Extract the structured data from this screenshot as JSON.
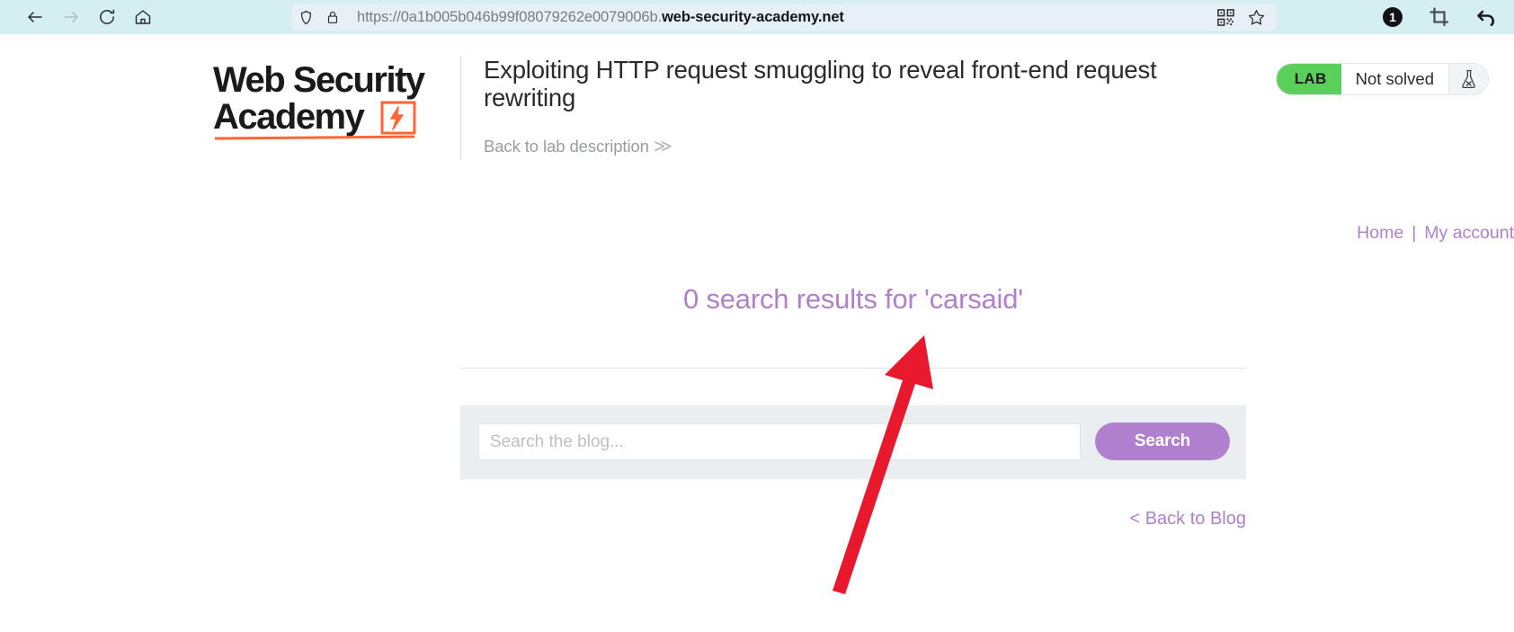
{
  "browser": {
    "nav": {
      "back_icon": "arrow-left-icon",
      "forward_icon": "arrow-right-icon",
      "reload_icon": "reload-icon",
      "home_icon": "home-icon"
    },
    "url_bar": {
      "shield_icon": "shield-icon",
      "lock_icon": "lock-icon",
      "url_prefix": "https://0a1b005b046b99f08079262e0079006b.",
      "url_domain": "web-security-academy.net",
      "qr_icon": "qr-code-icon",
      "bookmark_icon": "star-icon"
    },
    "extensions": {
      "badge_count": "1",
      "badge_icon": "circle-badge-icon",
      "crop_icon": "crop-icon",
      "undo_icon": "undo-arrow-icon"
    }
  },
  "lab_header": {
    "logo": {
      "line1": "Web Security",
      "line2": "Academy",
      "mark_icon": "lightning-bolt-icon"
    },
    "title": "Exploiting HTTP request smuggling to reveal front-end request rewriting",
    "back_link": "Back to lab description",
    "back_link_chevron": "≫",
    "status": {
      "tag": "LAB",
      "state": "Not solved",
      "flask_icon": "flask-x-icon",
      "tag_color": "#5ad05a"
    },
    "rule_color": "#ff6633"
  },
  "page": {
    "nav_links": [
      {
        "label": "Home"
      },
      {
        "label": "My account"
      }
    ],
    "nav_separator": "|",
    "results_heading": "0 search results for 'carsaid'",
    "search": {
      "placeholder": "Search the blog...",
      "value": "",
      "button_label": "Search",
      "button_color": "#b07fce"
    },
    "back_to_blog": "< Back to Blog",
    "accent_color": "#b07fce"
  },
  "annotation": {
    "arrow_color": "#e8192c",
    "arrow_icon": "red-arrow-up-right"
  }
}
